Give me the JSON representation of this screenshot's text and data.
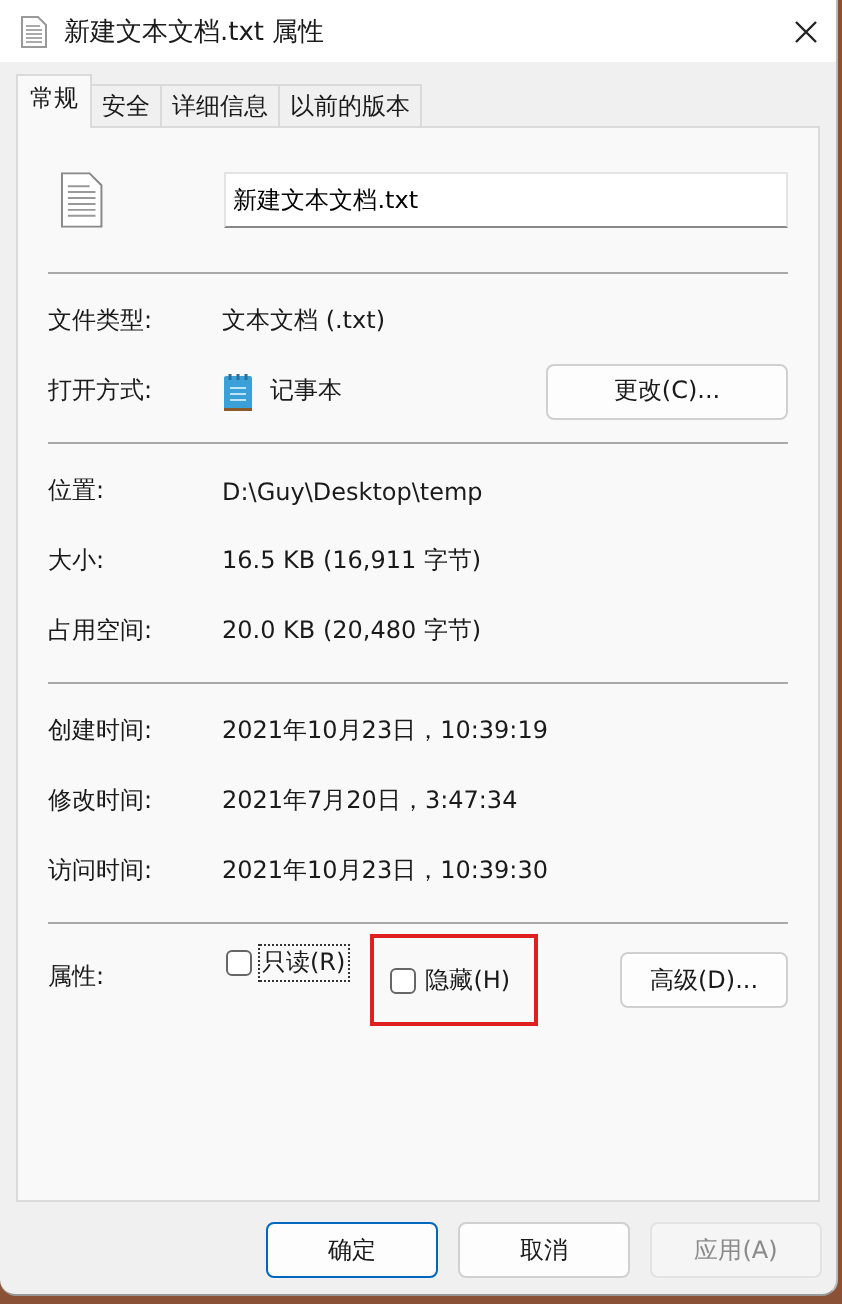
{
  "window": {
    "title": "新建文本文档.txt 属性"
  },
  "tabs": [
    {
      "label": "常规",
      "selected": true
    },
    {
      "label": "安全",
      "selected": false
    },
    {
      "label": "详细信息",
      "selected": false
    },
    {
      "label": "以前的版本",
      "selected": false
    }
  ],
  "file_name": {
    "value": "新建文本文档.txt"
  },
  "sections": [
    [
      {
        "label": "文件类型:",
        "value": "文本文档 (.txt)",
        "kind": "text"
      },
      {
        "label": "打开方式:",
        "value": "记事本",
        "kind": "app",
        "button": "更改(C)..."
      }
    ],
    [
      {
        "label": "位置:",
        "value": "D:\\Guy\\Desktop\\temp",
        "kind": "text"
      },
      {
        "label": "大小:",
        "value": "16.5 KB (16,911 字节)",
        "kind": "text"
      },
      {
        "label": "占用空间:",
        "value": "20.0 KB (20,480 字节)",
        "kind": "text"
      }
    ],
    [
      {
        "label": "创建时间:",
        "value": "2021年10月23日，10:39:19",
        "kind": "text"
      },
      {
        "label": "修改时间:",
        "value": "2021年7月20日，3:47:34",
        "kind": "text"
      },
      {
        "label": "访问时间:",
        "value": "2021年10月23日，10:39:30",
        "kind": "text"
      }
    ]
  ],
  "attributes": {
    "label": "属性:",
    "checkboxes": [
      {
        "label": "只读(R)",
        "checked": false,
        "focused": true,
        "highlighted": false
      },
      {
        "label": "隐藏(H)",
        "checked": false,
        "focused": false,
        "highlighted": true
      }
    ],
    "button": "高级(D)..."
  },
  "buttons": [
    {
      "label": "确定",
      "default": true,
      "disabled": false
    },
    {
      "label": "取消",
      "default": false,
      "disabled": false
    },
    {
      "label": "应用(A)",
      "default": false,
      "disabled": true
    }
  ]
}
